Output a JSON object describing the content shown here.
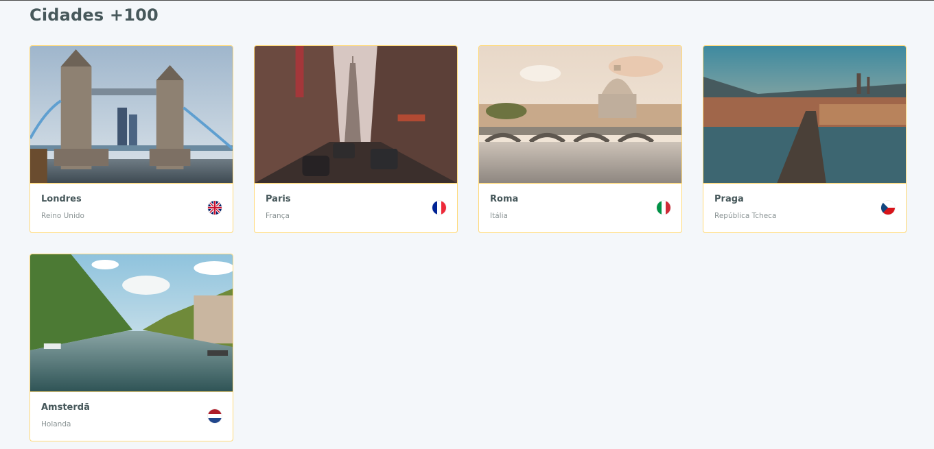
{
  "section": {
    "title": "Cidades +100"
  },
  "cities": [
    {
      "name": "Londres",
      "country": "Reino Unido",
      "flag": "uk-flag-icon"
    },
    {
      "name": "Paris",
      "country": "França",
      "flag": "france-flag-icon"
    },
    {
      "name": "Roma",
      "country": "Itália",
      "flag": "italy-flag-icon"
    },
    {
      "name": "Praga",
      "country": "República Tcheca",
      "flag": "czech-flag-icon"
    },
    {
      "name": "Amsterdã",
      "country": "Holanda",
      "flag": "netherlands-flag-icon"
    }
  ],
  "colors": {
    "border_accent": "#FFBA08",
    "text": "#47585B",
    "background": "#F4F7FA"
  }
}
